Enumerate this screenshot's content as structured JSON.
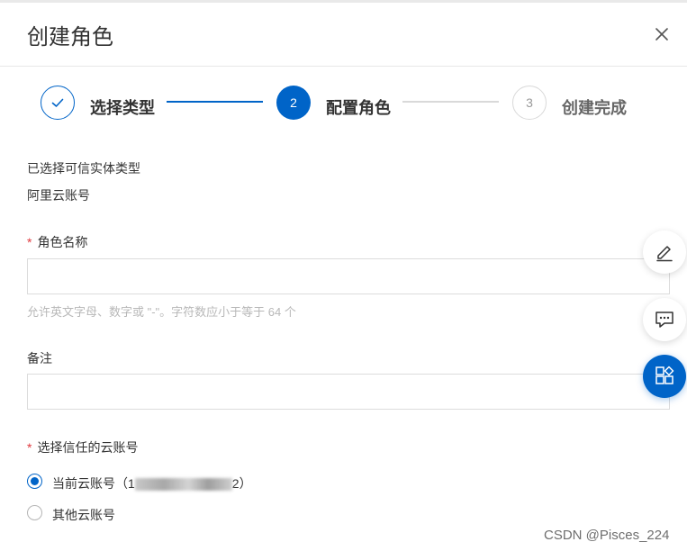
{
  "dialog": {
    "title": "创建角色",
    "close_icon": "close-icon"
  },
  "steps": [
    {
      "label": "选择类型",
      "status": "done",
      "icon": "check-icon"
    },
    {
      "number": "2",
      "label": "配置角色",
      "status": "active"
    },
    {
      "number": "3",
      "label": "创建完成",
      "status": "pending"
    }
  ],
  "colors": {
    "primary": "#0064c8",
    "required": "#e0393e",
    "pending": "#999999"
  },
  "form": {
    "entity_type_label": "已选择可信实体类型",
    "entity_type_value": "阿里云账号",
    "required_mark": "*",
    "role_name_label": "角色名称",
    "role_name_value": "",
    "role_name_hint": "允许英文字母、数字或 \"-\"。字符数应小于等于 64 个",
    "remark_label": "备注",
    "remark_value": "",
    "trusted_account_label": "选择信任的云账号",
    "options": [
      {
        "label_prefix": "当前云账号（1",
        "label_suffix": "2）",
        "checked": true
      },
      {
        "label": "其他云账号",
        "checked": false
      }
    ]
  },
  "floating_buttons": [
    {
      "icon": "edit-icon"
    },
    {
      "icon": "feedback-icon"
    },
    {
      "icon": "apps-icon",
      "active": true
    }
  ],
  "watermark": "CSDN @Pisces_224"
}
